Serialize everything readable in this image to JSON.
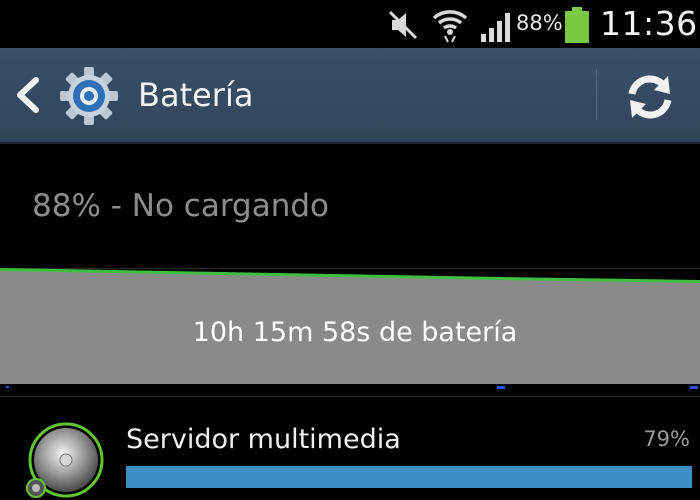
{
  "status_bar": {
    "battery_percent": "88%",
    "time": "11:36",
    "icons": [
      "mute-icon",
      "wifi-icon",
      "signal-icon",
      "battery-icon"
    ],
    "battery_color": "#7ac943"
  },
  "action_bar": {
    "title": "Batería",
    "icons": [
      "back-icon",
      "gear-icon",
      "refresh-icon"
    ],
    "background": "#34495f"
  },
  "battery": {
    "status": "88% - No cargando",
    "time_on_battery": "10h 15m 58s de batería",
    "graph_line_color": "#3fbf3f",
    "graph_fill_color": "#8a8a8a",
    "level_start": 0.88,
    "level_end": 0.84
  },
  "usage": [
    {
      "name": "Servidor multimedia",
      "percent_label": "79%",
      "percent": 0.79,
      "bar_color": "#3e8dc5",
      "icon": "media-server-icon"
    }
  ]
}
